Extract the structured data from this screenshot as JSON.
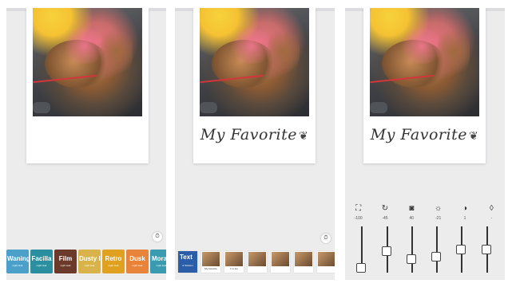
{
  "panel1": {
    "filters": [
      {
        "label": "Waning",
        "sub": "Light leak",
        "color": "#4aa0c8"
      },
      {
        "label": "Facilla",
        "sub": "Light leak",
        "color": "#2b8fa0"
      },
      {
        "label": "Film",
        "sub": "Light leak",
        "color": "#6b3a2a"
      },
      {
        "label": "Dusty I",
        "sub": "Light leak",
        "color": "#d8b34a"
      },
      {
        "label": "Retro",
        "sub": "Light leak",
        "color": "#e0a020"
      },
      {
        "label": "Dusk",
        "sub": "Light leak",
        "color": "#e8843a"
      },
      {
        "label": "Moran",
        "sub": "Light leak",
        "color": "#3a9ab0"
      }
    ],
    "timer_icon": "clock-icon"
  },
  "panel2": {
    "caption": "My Favorite",
    "caption_icon": "heart-icon",
    "stickers": [
      {
        "type": "text",
        "label": "Text",
        "sub": "& Stickers"
      },
      {
        "type": "photo",
        "label": "My Favorite"
      },
      {
        "type": "photo",
        "label": "1 to ten"
      },
      {
        "type": "photo",
        "label": ""
      },
      {
        "type": "photo",
        "label": ""
      },
      {
        "type": "photo",
        "label": ""
      },
      {
        "type": "photo",
        "label": ""
      }
    ],
    "timer_icon": "clock-icon"
  },
  "panel3": {
    "caption": "My Favorite",
    "adjustments": [
      {
        "icon": "crop-icon",
        "glyph": "⛶",
        "value": "-100",
        "level": 0.0
      },
      {
        "icon": "rotate-icon",
        "glyph": "↻",
        "value": "-45",
        "level": 0.45
      },
      {
        "icon": "vignette-icon",
        "glyph": "◙",
        "value": "40",
        "level": 0.25
      },
      {
        "icon": "brightness-icon",
        "glyph": "☼",
        "value": "-21",
        "level": 0.3
      },
      {
        "icon": "contrast-icon",
        "glyph": "◑",
        "value": "1",
        "level": 0.5
      },
      {
        "icon": "saturation-icon",
        "glyph": "◊",
        "value": "-",
        "level": 0.5
      }
    ]
  }
}
